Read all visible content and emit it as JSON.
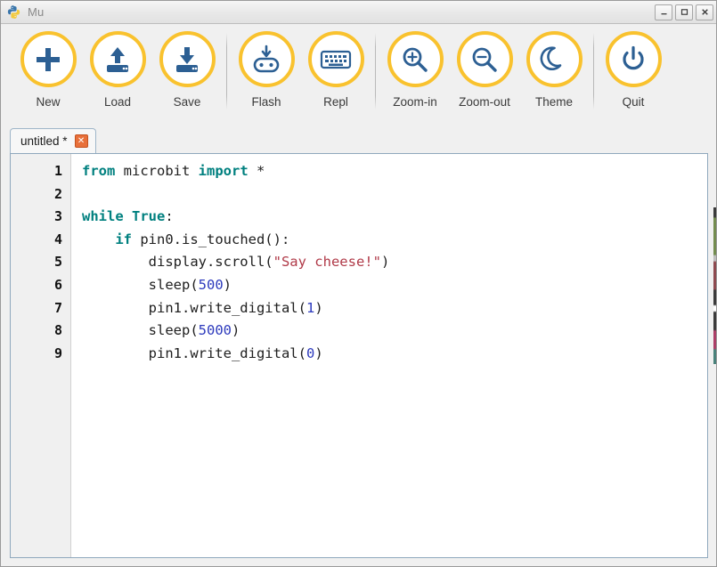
{
  "window": {
    "title": "Mu",
    "app_icon": "python-logo-icon",
    "controls": [
      {
        "name": "minimize",
        "glyph": "–"
      },
      {
        "name": "maximize",
        "glyph": "❑"
      },
      {
        "name": "close",
        "glyph": "×"
      }
    ]
  },
  "toolbar": {
    "items": [
      {
        "label": "New",
        "icon": "plus-icon"
      },
      {
        "label": "Load",
        "icon": "upload-icon"
      },
      {
        "label": "Save",
        "icon": "download-save-icon"
      },
      {
        "label": "Flash",
        "icon": "microbit-flash-icon"
      },
      {
        "label": "Repl",
        "icon": "keyboard-icon"
      },
      {
        "label": "Zoom-in",
        "icon": "magnifier-plus-icon"
      },
      {
        "label": "Zoom-out",
        "icon": "magnifier-minus-icon"
      },
      {
        "label": "Theme",
        "icon": "moon-icon"
      },
      {
        "label": "Quit",
        "icon": "power-icon"
      }
    ],
    "separator_after": [
      2,
      4,
      7
    ],
    "accent_color": "#f9c22e",
    "icon_color": "#2c5f93"
  },
  "tabs": [
    {
      "label": "untitled *",
      "close_glyph": "✕",
      "active": true
    }
  ],
  "editor": {
    "line_numbers": [
      "1",
      "2",
      "3",
      "4",
      "5",
      "6",
      "7",
      "8",
      "9"
    ],
    "lines": [
      [
        {
          "t": "from",
          "c": "k"
        },
        {
          "t": " microbit ",
          "c": "p"
        },
        {
          "t": "import",
          "c": "k"
        },
        {
          "t": " *",
          "c": "p"
        }
      ],
      [
        {
          "t": "",
          "c": "p"
        }
      ],
      [
        {
          "t": "while",
          "c": "k"
        },
        {
          "t": " ",
          "c": "p"
        },
        {
          "t": "True",
          "c": "k"
        },
        {
          "t": ":",
          "c": "p"
        }
      ],
      [
        {
          "t": "    ",
          "c": "p"
        },
        {
          "t": "if",
          "c": "k"
        },
        {
          "t": " pin0.is_touched():",
          "c": "p"
        }
      ],
      [
        {
          "t": "        display.scroll(",
          "c": "p"
        },
        {
          "t": "\"Say cheese!\"",
          "c": "s"
        },
        {
          "t": ")",
          "c": "p"
        }
      ],
      [
        {
          "t": "        sleep(",
          "c": "p"
        },
        {
          "t": "500",
          "c": "n"
        },
        {
          "t": ")",
          "c": "p"
        }
      ],
      [
        {
          "t": "        pin1.write_digital(",
          "c": "p"
        },
        {
          "t": "1",
          "c": "n"
        },
        {
          "t": ")",
          "c": "p"
        }
      ],
      [
        {
          "t": "        sleep(",
          "c": "p"
        },
        {
          "t": "5000",
          "c": "n"
        },
        {
          "t": ")",
          "c": "p"
        }
      ],
      [
        {
          "t": "        pin1.write_digital(",
          "c": "p"
        },
        {
          "t": "0",
          "c": "n"
        },
        {
          "t": ")",
          "c": "p"
        }
      ]
    ],
    "syntax_colors": {
      "keyword": "#00807f",
      "string": "#b03a48",
      "number": "#2e3bbd",
      "plain": "#202020"
    }
  }
}
